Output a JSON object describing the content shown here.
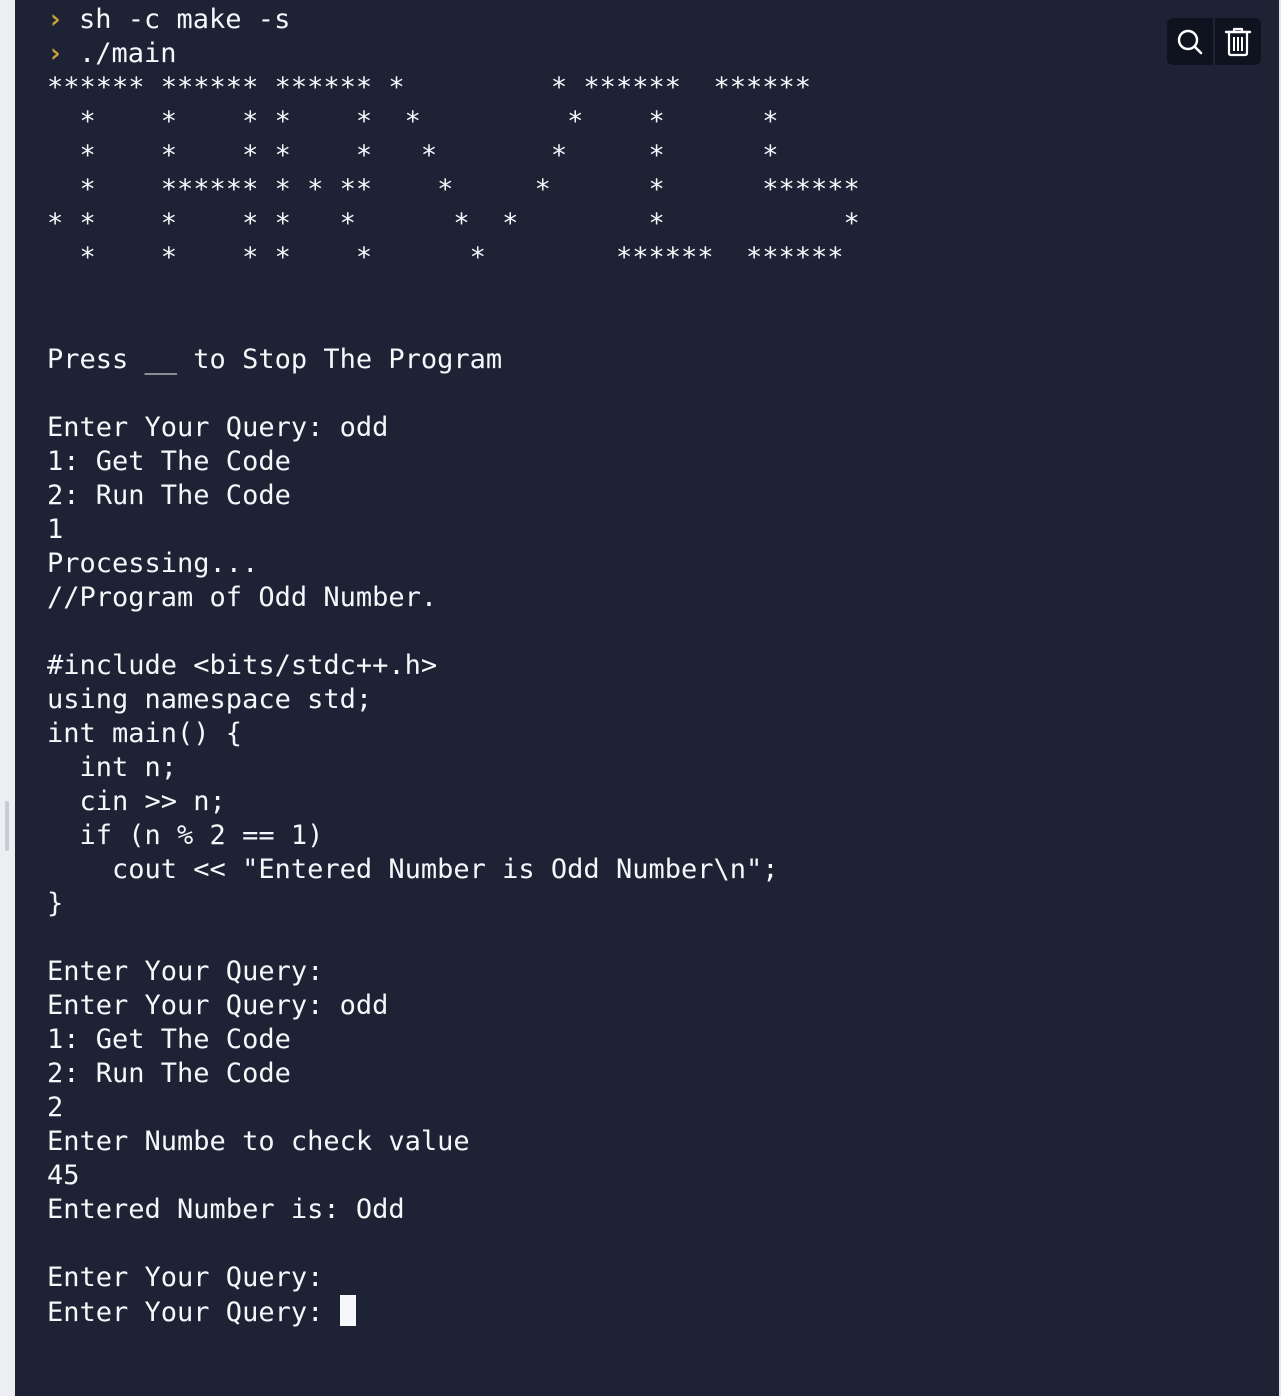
{
  "commands": [
    {
      "prompt": ">",
      "text": "sh -c make -s"
    },
    {
      "prompt": ">",
      "text": "./main"
    }
  ],
  "banner": [
    "****** ****** ****** *         * ******  ******",
    "  *    *    * *    *  *         *    *      *",
    "  *    *    * *    *   *       *     *      *",
    "  *    ****** * * **    *     *      *      ******",
    "* *    *    * *   *      *  *        *           *",
    "  *    *    * *    *      *        ******  ******"
  ],
  "output": [
    "",
    "",
    "Press __ to Stop The Program",
    "",
    "Enter Your Query: odd",
    "1: Get The Code",
    "2: Run The Code",
    "1",
    "Processing...",
    "//Program of Odd Number.",
    "",
    "#include <bits/stdc++.h>",
    "using namespace std;",
    "int main() {",
    "  int n;",
    "  cin >> n;",
    "  if (n % 2 == 1)",
    "    cout << \"Entered Number is Odd Number\\n\";",
    "}",
    "",
    "Enter Your Query:",
    "Enter Your Query: odd",
    "1: Get The Code",
    "2: Run The Code",
    "2",
    "Enter Numbe to check value",
    "45",
    "Entered Number is: Odd",
    "",
    "Enter Your Query:"
  ],
  "current_prompt": "Enter Your Query: ",
  "toolbar": {
    "search_icon": "search-icon",
    "clear_icon": "trash-icon"
  },
  "colors": {
    "background": "#1e2235",
    "text": "#f5f7fb",
    "prompt_arrow": "#c8a23a",
    "toolbar_button": "#0f1320"
  }
}
